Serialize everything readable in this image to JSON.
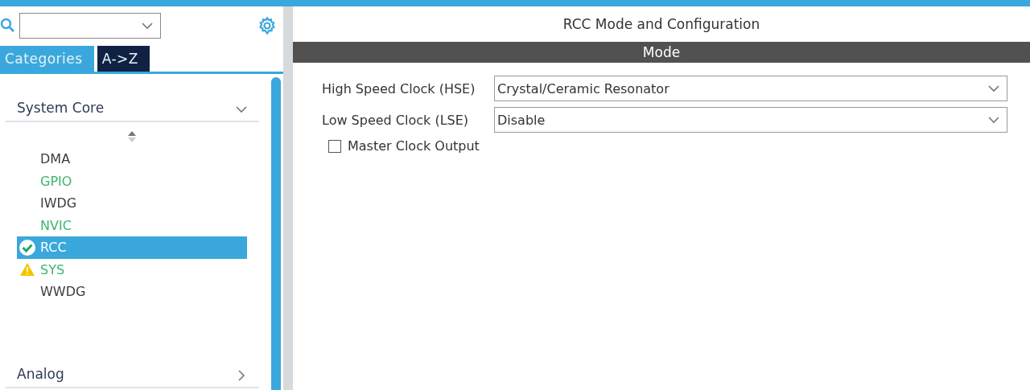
{
  "sidebar": {
    "tabs": [
      {
        "label": "Categories",
        "selected": true
      },
      {
        "label": "A->Z",
        "selected": false
      }
    ],
    "categories": [
      {
        "label": "System Core",
        "expanded": true,
        "items": [
          {
            "kind": "plain",
            "label": "DMA",
            "color": "#3c3c3c",
            "selected": false
          },
          {
            "kind": "plain",
            "label": "GPIO",
            "color": "#3cb46e",
            "selected": false
          },
          {
            "kind": "plain",
            "label": "IWDG",
            "color": "#3c3c3c",
            "selected": false
          },
          {
            "kind": "plain",
            "label": "NVIC",
            "color": "#3cb46e",
            "selected": false
          },
          {
            "kind": "ok",
            "label": "RCC",
            "color": "#ffffff",
            "selected": true
          },
          {
            "kind": "warning",
            "label": "SYS",
            "color": "#3cb46e",
            "selected": false
          },
          {
            "kind": "plain",
            "label": "WWDG",
            "color": "#3c3c3c",
            "selected": false
          }
        ]
      },
      {
        "label": "Analog",
        "expanded": false
      }
    ]
  },
  "panel": {
    "title": "RCC Mode and Configuration",
    "section": "Mode",
    "fields": [
      {
        "kind": "select",
        "label": "High Speed Clock (HSE)",
        "value": "Crystal/Ceramic Resonator"
      },
      {
        "kind": "select",
        "label": "Low Speed Clock (LSE)",
        "value": "Disable"
      },
      {
        "kind": "checkbox",
        "label": "Master Clock Output",
        "checked": false
      }
    ]
  }
}
